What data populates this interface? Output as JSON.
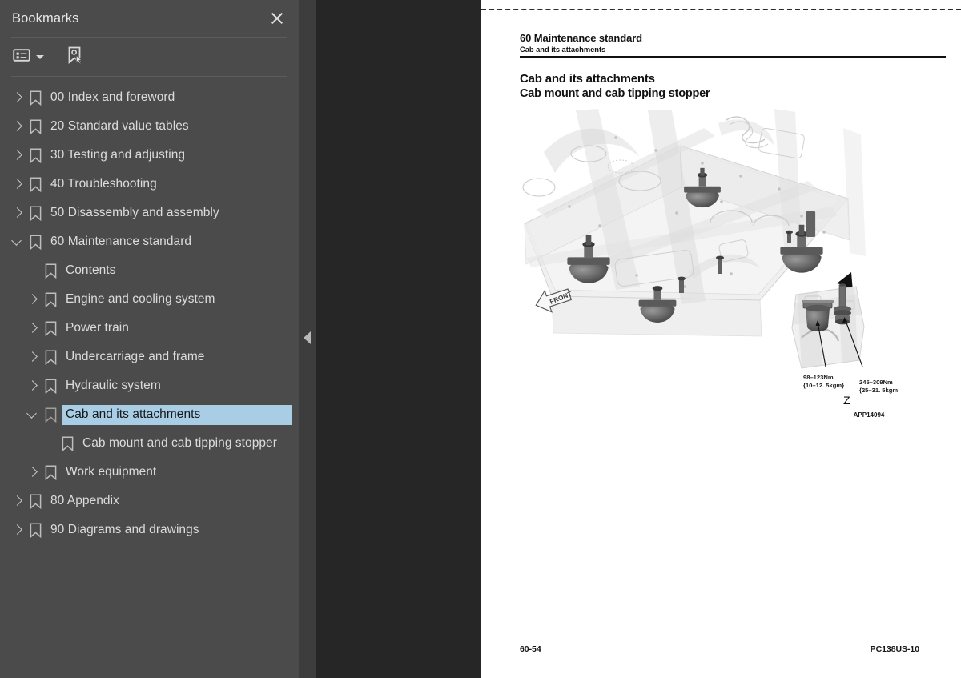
{
  "sidebar": {
    "title": "Bookmarks",
    "close_icon": "close-icon",
    "toolbar": {
      "options_icon": "list-options-icon",
      "find_bookmark_icon": "find-bookmark-icon"
    },
    "items": [
      {
        "label": "00 Index and foreword",
        "level": 0,
        "state": "collapsed",
        "selected": false
      },
      {
        "label": "20 Standard value tables",
        "level": 0,
        "state": "collapsed",
        "selected": false
      },
      {
        "label": "30 Testing and adjusting",
        "level": 0,
        "state": "collapsed",
        "selected": false
      },
      {
        "label": "40 Troubleshooting",
        "level": 0,
        "state": "collapsed",
        "selected": false
      },
      {
        "label": "50 Disassembly and assembly",
        "level": 0,
        "state": "collapsed",
        "selected": false
      },
      {
        "label": "60 Maintenance standard",
        "level": 0,
        "state": "expanded",
        "selected": false
      },
      {
        "label": "Contents",
        "level": 1,
        "state": "none",
        "selected": false
      },
      {
        "label": "Engine and cooling system",
        "level": 1,
        "state": "collapsed",
        "selected": false
      },
      {
        "label": "Power train",
        "level": 1,
        "state": "collapsed",
        "selected": false
      },
      {
        "label": "Undercarriage and frame",
        "level": 1,
        "state": "collapsed",
        "selected": false
      },
      {
        "label": "Hydraulic system",
        "level": 1,
        "state": "collapsed",
        "selected": false
      },
      {
        "label": "Cab and its attachments",
        "level": 1,
        "state": "expanded",
        "selected": true
      },
      {
        "label": "Cab mount and cab tipping stopper",
        "level": 2,
        "state": "none",
        "selected": false
      },
      {
        "label": "Work equipment",
        "level": 1,
        "state": "collapsed",
        "selected": false
      },
      {
        "label": "80 Appendix",
        "level": 0,
        "state": "collapsed",
        "selected": false
      },
      {
        "label": "90 Diagrams and drawings",
        "level": 0,
        "state": "collapsed",
        "selected": false
      }
    ]
  },
  "splitter": {
    "collapse_icon": "collapse-left-triangle-icon"
  },
  "document": {
    "running_head": {
      "main": "60 Maintenance standard",
      "sub": "Cab and its attachments"
    },
    "title_line1": "Cab and its attachments",
    "title_line2": "Cab mount and cab tipping stopper",
    "figure": {
      "front_marker": "FRONT",
      "detail_callout": "Z",
      "detail_view_label": "Z",
      "torque_left_line1": "98–123Nm",
      "torque_left_line2": "{10–12. 5kgm}",
      "torque_right_line1": "245–309Nm",
      "torque_right_line2": "{25–31. 5kgm}",
      "figure_id": "APP14094"
    },
    "footer_left": "60-54",
    "footer_right": "PC138US-10"
  },
  "colors": {
    "sidebar_bg": "#4b4b4b",
    "splitter_bg": "#3d3d3d",
    "viewer_bg": "#262626",
    "selection": "#a9cde4",
    "page_bg": "#ffffff",
    "text_light": "#dcdcdc"
  }
}
